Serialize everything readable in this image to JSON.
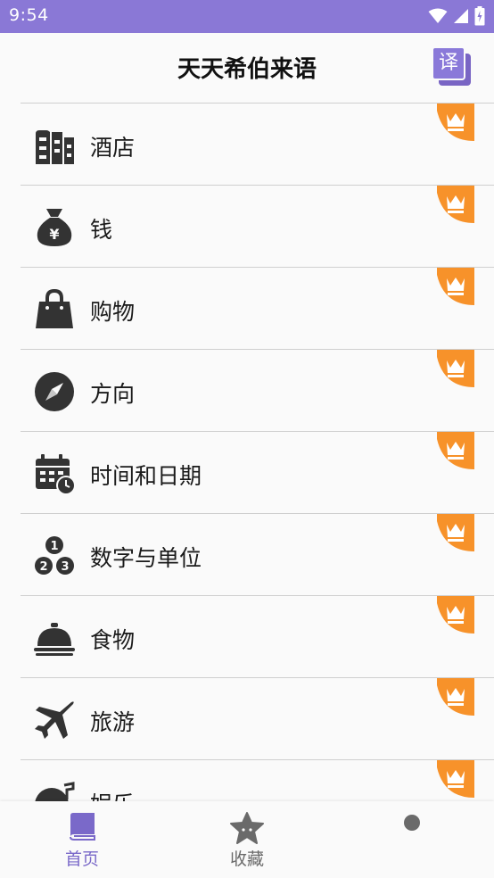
{
  "status_bar": {
    "time": "9:54",
    "background": "#8a78d6",
    "icons": [
      "wifi-icon",
      "signal-icon",
      "battery-icon"
    ]
  },
  "header": {
    "title": "天天希伯来语",
    "translate_button_label": "译",
    "accent": "#8a79d9"
  },
  "categories": [
    {
      "label": "酒店",
      "icon": "hotel-icon",
      "premium": true
    },
    {
      "label": "钱",
      "icon": "money-bag-icon",
      "premium": true
    },
    {
      "label": "购物",
      "icon": "shopping-bag-icon",
      "premium": true
    },
    {
      "label": "方向",
      "icon": "compass-icon",
      "premium": true
    },
    {
      "label": "时间和日期",
      "icon": "calendar-clock-icon",
      "premium": true
    },
    {
      "label": "数字与单位",
      "icon": "numbers-icon",
      "premium": true
    },
    {
      "label": "食物",
      "icon": "food-cloche-icon",
      "premium": true
    },
    {
      "label": "旅游",
      "icon": "airplane-icon",
      "premium": true
    },
    {
      "label": "娱乐",
      "icon": "music-record-icon",
      "premium": true
    }
  ],
  "premium_badge": {
    "icon": "crown-icon",
    "color": "#f7922a"
  },
  "bottom_nav": {
    "items": [
      {
        "label": "首页",
        "icon": "book-icon",
        "active": true,
        "color": "#7a69c9"
      },
      {
        "label": "收藏",
        "icon": "star-icon",
        "active": false,
        "color": "#6a6a6a"
      }
    ],
    "extra_icon": "dot-icon"
  }
}
